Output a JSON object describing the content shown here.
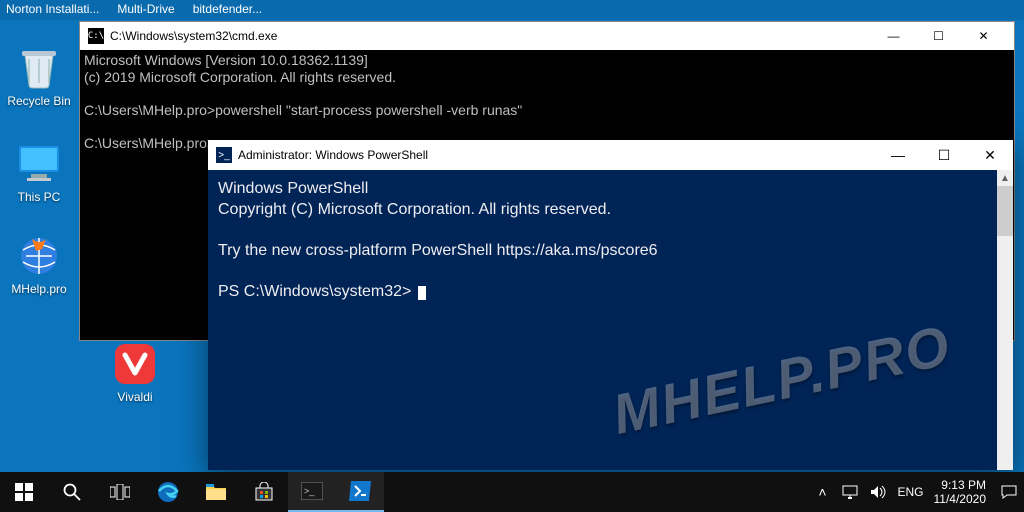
{
  "bookmarks": {
    "b1": "Norton Installati...",
    "b2": "Multi-Drive",
    "b3": "bitdefender..."
  },
  "desktop_icons": {
    "recycle": "Recycle Bin",
    "thispc": "This PC",
    "mhelp": "MHelp.pro",
    "vivaldi": "Vivaldi"
  },
  "cmd": {
    "title": "C:\\Windows\\system32\\cmd.exe",
    "l1": "Microsoft Windows [Version 10.0.18362.1139]",
    "l2": "(c) 2019 Microsoft Corporation. All rights reserved.",
    "l3": "C:\\Users\\MHelp.pro>powershell \"start-process powershell -verb runas\"",
    "l4": "C:\\Users\\MHelp.pro>"
  },
  "ps": {
    "title": "Administrator: Windows PowerShell",
    "l1": "Windows PowerShell",
    "l2": "Copyright (C) Microsoft Corporation. All rights reserved.",
    "l3": "Try the new cross-platform PowerShell https://aka.ms/pscore6",
    "prompt": "PS C:\\Windows\\system32> "
  },
  "watermark": "MHELP.PRO",
  "tray": {
    "lang": "ENG",
    "time": "9:13 PM",
    "date": "11/4/2020"
  }
}
